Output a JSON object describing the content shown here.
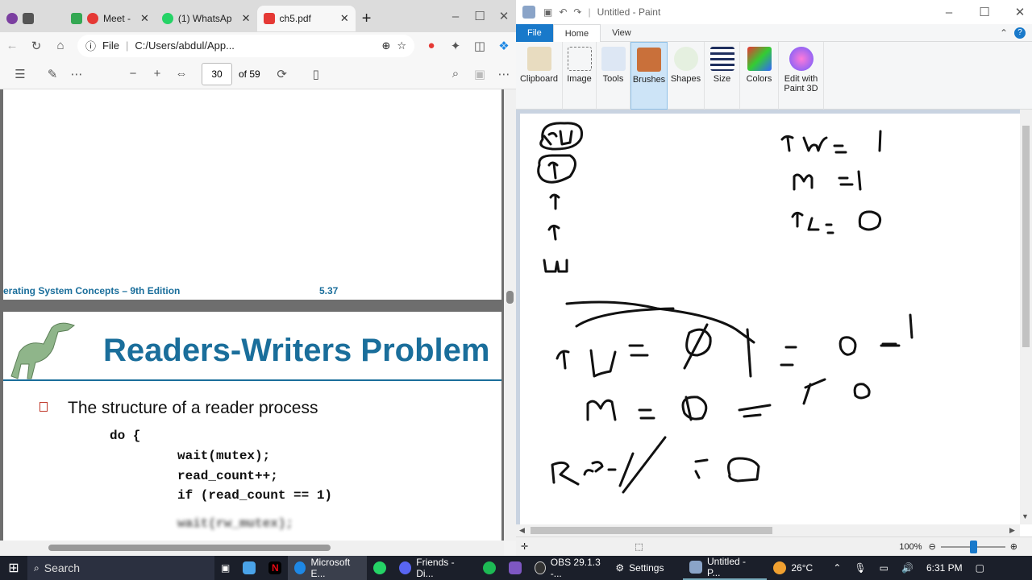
{
  "browser": {
    "tabs": [
      {
        "label": "Meet -",
        "color": "#34a853"
      },
      {
        "label": "(1) WhatsAp",
        "color": "#25d366"
      },
      {
        "label": "ch5.pdf",
        "color": "#e53935"
      }
    ],
    "file_label": "File",
    "url": "C:/Users/abdul/App...",
    "page_current": "30",
    "page_total": "of 59"
  },
  "pdf": {
    "footer_left": "erating System Concepts – 9th Edition",
    "footer_right": "5.37",
    "slide_title": "Readers-Writers Problem",
    "bullet": "The structure of a reader process",
    "code": [
      "do {",
      "wait(mutex);",
      "read_count++;",
      "if (read_count == 1)",
      "wait(rw_mutex);"
    ]
  },
  "paint": {
    "title": "Untitled - Paint",
    "tabs": [
      "File",
      "Home",
      "View"
    ],
    "groups": [
      "Clipboard",
      "Image",
      "Tools",
      "Brushes",
      "Shapes",
      "Size",
      "Colors",
      "Edit with Paint 3D"
    ],
    "zoom": "100%",
    "accent": "#1979ca"
  },
  "taskbar": {
    "search": "Search",
    "items": [
      "Microsoft E...",
      "Friends - Di...",
      "OBS 29.1.3 -...",
      "Settings",
      "Untitled - P..."
    ],
    "temperature": "26°C",
    "time": "6:31 PM"
  }
}
